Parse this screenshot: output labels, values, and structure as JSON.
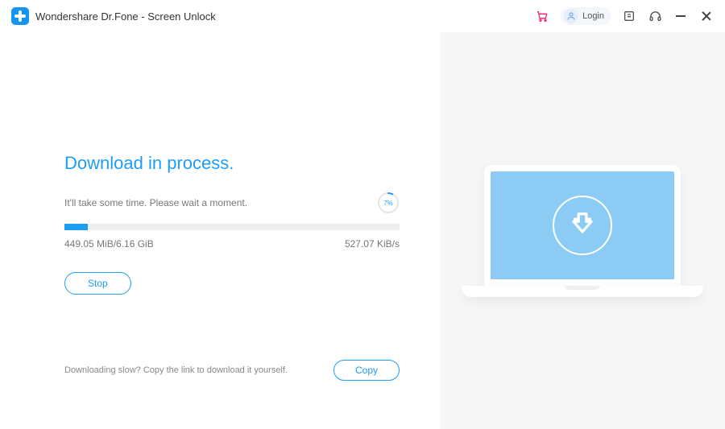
{
  "window": {
    "title": "Wondershare Dr.Fone - Screen Unlock",
    "login_label": "Login"
  },
  "main": {
    "heading": "Download in process.",
    "subtitle": "It'll take some time. Please wait a moment.",
    "percent_label": "7%",
    "percent_value": 7,
    "progress_width_pct": "7%",
    "downloaded": "449.05 MiB/6.16 GiB",
    "speed": "527.07 KiB/s",
    "stop_label": "Stop"
  },
  "footer": {
    "hint": "Downloading slow? Copy the link to download it yourself.",
    "copy_label": "Copy"
  },
  "colors": {
    "accent": "#1e9df4"
  }
}
